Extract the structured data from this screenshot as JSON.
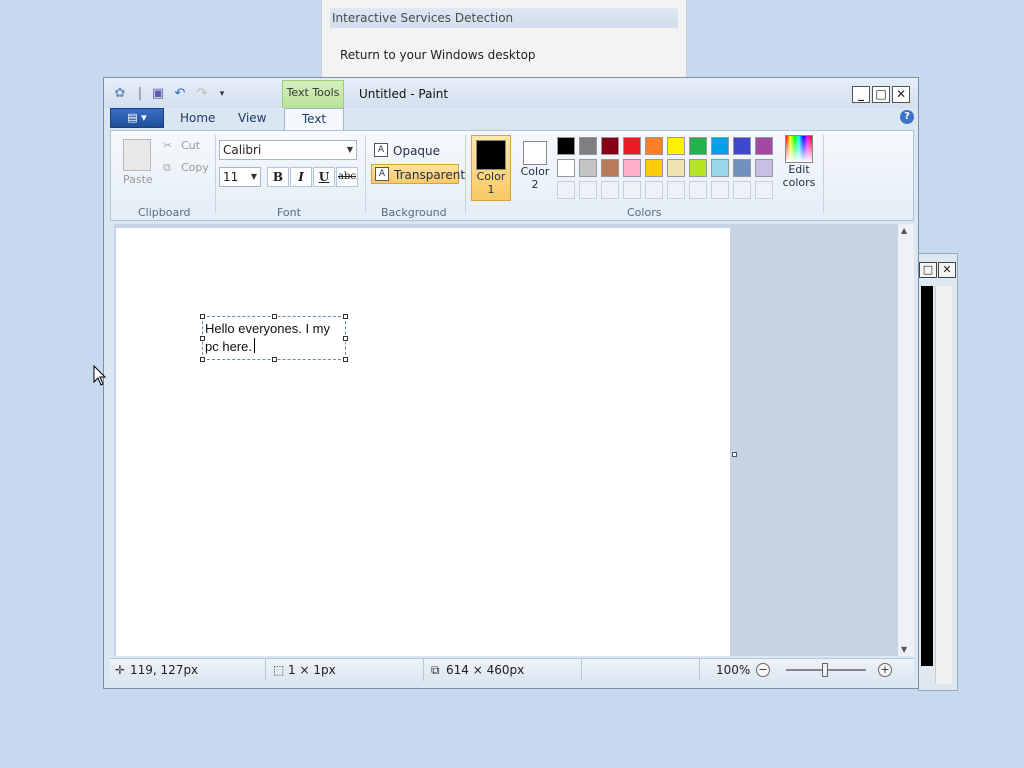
{
  "dialog": {
    "title": "Interactive Services Detection",
    "option": "Return to your Windows desktop"
  },
  "window": {
    "title": "Untitled - Paint",
    "context_tab": "Text Tools",
    "min": "_",
    "max": "□",
    "close": "✕"
  },
  "tabs": {
    "home": "Home",
    "view": "View",
    "text": "Text",
    "help": "?"
  },
  "ribbon": {
    "clipboard": {
      "label": "Clipboard",
      "paste": "Paste",
      "cut": "Cut",
      "copy": "Copy"
    },
    "font": {
      "label": "Font",
      "family": "Calibri",
      "size": "11",
      "bold": "B",
      "italic": "I",
      "underline": "U",
      "strike": "abc"
    },
    "background": {
      "label": "Background",
      "opaque": "Opaque",
      "transparent": "Transparent"
    },
    "colors": {
      "label": "Colors",
      "color1_line1": "Color",
      "color1_line2": "1",
      "color2_line1": "Color",
      "color2_line2": "2",
      "edit_line1": "Edit",
      "edit_line2": "colors",
      "color1_value": "#000000",
      "color2_value": "#ffffff",
      "row1": [
        "#000000",
        "#7f7f7f",
        "#880015",
        "#ed1c24",
        "#ff7f27",
        "#fff200",
        "#22b14c",
        "#00a2e8",
        "#3f48cc",
        "#a349a4"
      ],
      "row2": [
        "#ffffff",
        "#c3c3c3",
        "#b97a57",
        "#ffaec9",
        "#ffc90e",
        "#efe4b0",
        "#b5e61d",
        "#99d9ea",
        "#7092be",
        "#c8bfe7"
      ]
    }
  },
  "canvas": {
    "text_line1": "Hello everyones. I my",
    "text_line2": "pc here."
  },
  "status": {
    "cursor_pos": "119, 127px",
    "selection": "1 × 1px",
    "size": "614 × 460px",
    "zoom": "100%"
  },
  "bgwin": {
    "max": "□",
    "close": "✕"
  }
}
